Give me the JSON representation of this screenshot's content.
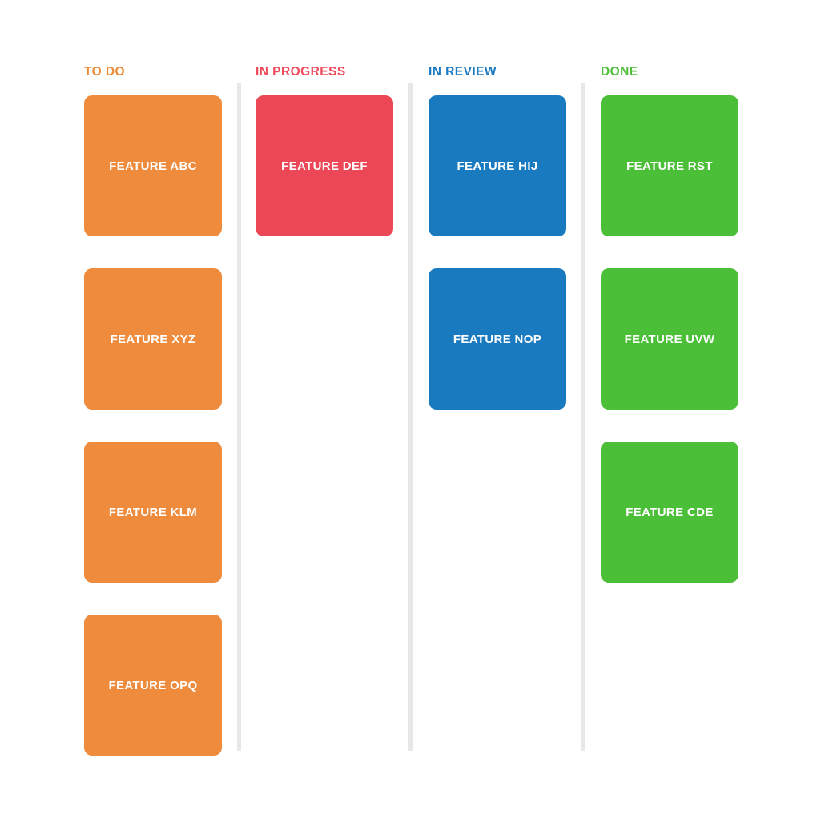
{
  "board": {
    "background_color": "#FFFFFF",
    "divider_color": "#E7E7E7",
    "card_text_color": "#FFFFFF",
    "columns": [
      {
        "id": "to-do",
        "title": "TO DO",
        "accent_color": "#ED8B37",
        "card_color": "#EE8B3C",
        "cards": [
          {
            "label": "FEATURE ABC"
          },
          {
            "label": "FEATURE XYZ"
          },
          {
            "label": "FEATURE KLM"
          },
          {
            "label": "FEATURE OPQ"
          }
        ]
      },
      {
        "id": "in-progress",
        "title": "IN PROGRESS",
        "accent_color": "#EF4959",
        "card_color": "#EB4756",
        "cards": [
          {
            "label": "FEATURE DEF"
          }
        ]
      },
      {
        "id": "in-review",
        "title": "IN REVIEW",
        "accent_color": "#1B7AC1",
        "card_color": "#1A7AC0",
        "cards": [
          {
            "label": "FEATURE HIJ"
          },
          {
            "label": "FEATURE NOP"
          }
        ]
      },
      {
        "id": "done",
        "title": "DONE",
        "accent_color": "#4FBF39",
        "card_color": "#4CBF39",
        "cards": [
          {
            "label": "FEATURE RST"
          },
          {
            "label": "FEATURE UVW"
          },
          {
            "label": "FEATURE CDE"
          }
        ]
      }
    ]
  }
}
